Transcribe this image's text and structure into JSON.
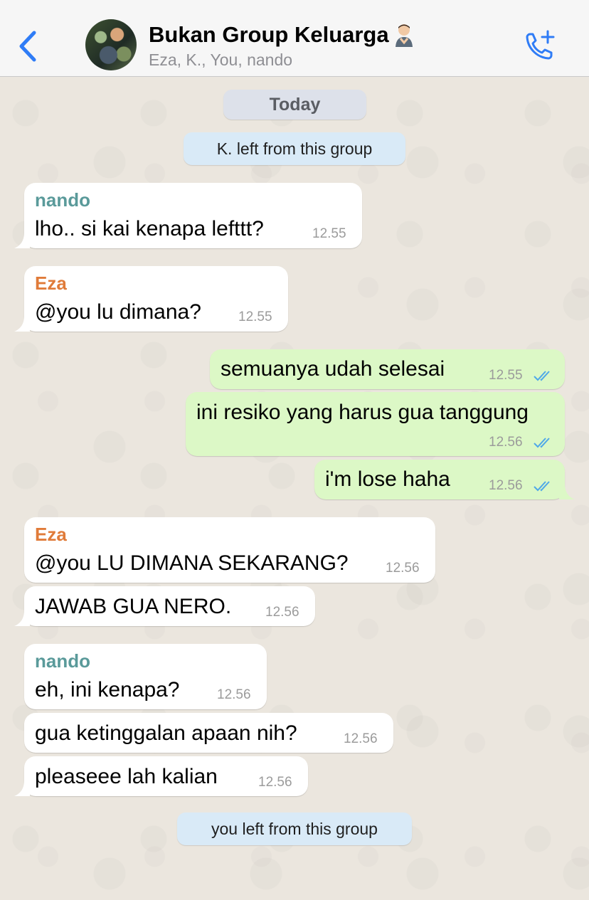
{
  "header": {
    "back_icon": "chevron-left-icon",
    "title": "Bukan Group Keluarga",
    "title_emoji": "person-shrugging-emoji",
    "subtitle": "Eza, K., You, nando",
    "call_icon": "add-call-icon"
  },
  "colors": {
    "accent": "#2f7cf6",
    "outgoing_bubble": "#dcf8c6",
    "incoming_bubble": "#ffffff",
    "system_chip": "#d9eaf7",
    "sender_nando": "#5a9a9a",
    "sender_eza": "#e07b39",
    "read_ticks": "#4fa8e8"
  },
  "date_chip": "Today",
  "system_messages": [
    "K. left from this group",
    "you left from this group"
  ],
  "messages": [
    {
      "sender": "nando",
      "text": "lho.. si kai kenapa lefttt?",
      "time": "12.55"
    },
    {
      "sender": "Eza",
      "text": "@you lu dimana?",
      "time": "12.55"
    },
    {
      "text": "semuanya udah selesai",
      "time": "12.55",
      "status": "read"
    },
    {
      "text": "ini resiko yang harus gua tanggung",
      "time": "12.56",
      "status": "read"
    },
    {
      "text": "i'm lose haha",
      "time": "12.56",
      "status": "read"
    },
    {
      "sender": "Eza",
      "text": "@you LU DIMANA SEKARANG?",
      "time": "12.56"
    },
    {
      "text": "JAWAB GUA NERO.",
      "time": "12.56"
    },
    {
      "sender": "nando",
      "text": "eh, ini kenapa?",
      "time": "12.56"
    },
    {
      "text": "gua ketinggalan apaan nih?",
      "time": "12.56"
    },
    {
      "text": "pleaseee lah kalian",
      "time": "12.56"
    }
  ]
}
